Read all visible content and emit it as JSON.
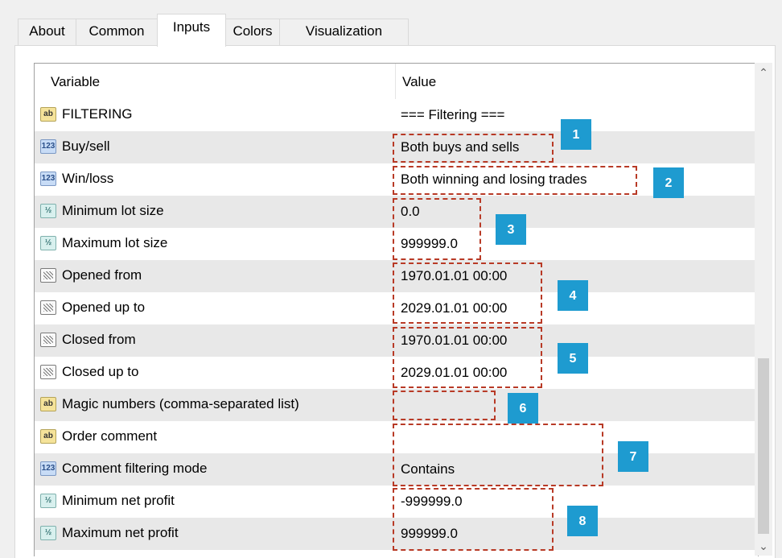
{
  "tabs": [
    {
      "label": "About"
    },
    {
      "label": "Common"
    },
    {
      "label": "Inputs"
    },
    {
      "label": "Colors"
    },
    {
      "label": "Visualization"
    }
  ],
  "active_tab": "Inputs",
  "grid": {
    "col_variable": "Variable",
    "col_value": "Value"
  },
  "rows": [
    {
      "icon": "ab",
      "icon_text": "ab",
      "name": "FILTERING",
      "value": "=== Filtering ==="
    },
    {
      "icon": "n123",
      "icon_text": "123",
      "name": "Buy/sell",
      "value": "Both buys and sells"
    },
    {
      "icon": "n123",
      "icon_text": "123",
      "name": "Win/loss",
      "value": "Both winning and losing trades"
    },
    {
      "icon": "half",
      "icon_text": "½",
      "name": "Minimum lot size",
      "value": "0.0"
    },
    {
      "icon": "half",
      "icon_text": "½",
      "name": "Maximum lot size",
      "value": "999999.0"
    },
    {
      "icon": "dt",
      "icon_text": "",
      "name": "Opened from",
      "value": "1970.01.01 00:00"
    },
    {
      "icon": "dt",
      "icon_text": "",
      "name": "Opened up to",
      "value": "2029.01.01 00:00"
    },
    {
      "icon": "dt",
      "icon_text": "",
      "name": "Closed from",
      "value": "1970.01.01 00:00"
    },
    {
      "icon": "dt",
      "icon_text": "",
      "name": "Closed up to",
      "value": "2029.01.01 00:00"
    },
    {
      "icon": "ab",
      "icon_text": "ab",
      "name": "Magic numbers (comma-separated list)",
      "value": ""
    },
    {
      "icon": "ab",
      "icon_text": "ab",
      "name": "Order comment",
      "value": ""
    },
    {
      "icon": "n123",
      "icon_text": "123",
      "name": "Comment filtering mode",
      "value": "Contains"
    },
    {
      "icon": "half",
      "icon_text": "½",
      "name": "Minimum net profit",
      "value": "-999999.0"
    },
    {
      "icon": "half",
      "icon_text": "½",
      "name": "Maximum net profit",
      "value": "999999.0"
    }
  ],
  "annotations": [
    "1",
    "2",
    "3",
    "4",
    "5",
    "6",
    "7",
    "8"
  ],
  "scrollbar": {
    "up": "^",
    "down": "v"
  }
}
